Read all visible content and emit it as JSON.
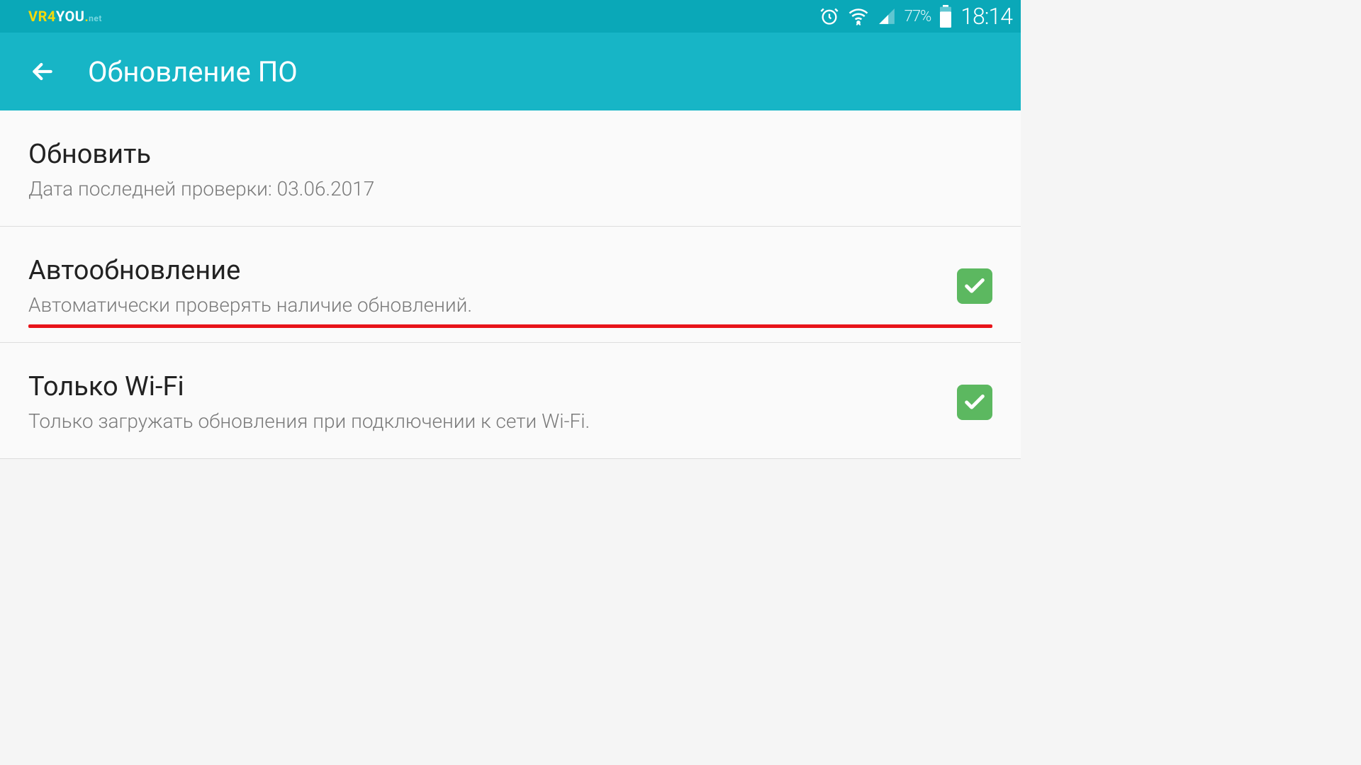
{
  "logo": {
    "part1": "VR4",
    "part2": "YOU",
    "dot": ".",
    "part3": "net"
  },
  "status": {
    "battery_pct": "77%",
    "time": "18:14"
  },
  "appbar": {
    "title": "Обновление ПО"
  },
  "settings": {
    "update": {
      "title": "Обновить",
      "desc": "Дата последней проверки: 03.06.2017"
    },
    "auto": {
      "title": "Автообновление",
      "desc": "Автоматически проверять наличие обновлений.",
      "checked": true
    },
    "wifi": {
      "title": "Только Wi-Fi",
      "desc": "Только загружать обновления при подключении к сети Wi-Fi.",
      "checked": true
    }
  }
}
